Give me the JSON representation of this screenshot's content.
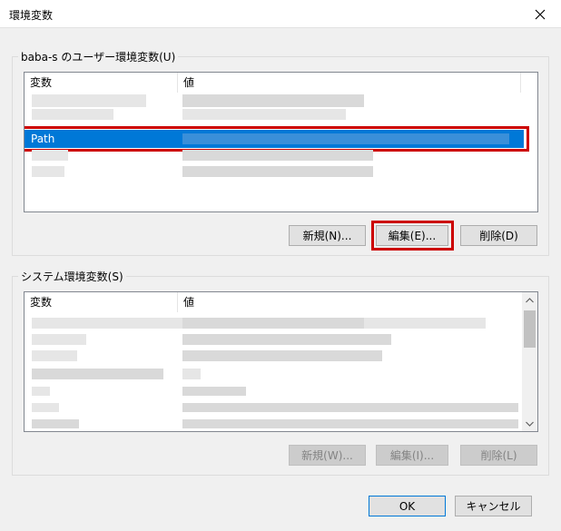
{
  "window": {
    "title": "環境変数"
  },
  "user_group": {
    "label": "baba-s のユーザー環境変数(U)",
    "columns": [
      "変数",
      "値"
    ],
    "selected_variable": "Path",
    "buttons": {
      "new": "新規(N)...",
      "edit": "編集(E)...",
      "delete": "削除(D)"
    }
  },
  "system_group": {
    "label": "システム環境変数(S)",
    "columns": [
      "変数",
      "値"
    ],
    "buttons": {
      "new": "新規(W)...",
      "edit": "編集(I)...",
      "delete": "削除(L)"
    }
  },
  "footer": {
    "ok": "OK",
    "cancel": "キャンセル"
  },
  "colors": {
    "selection": "#0078d7",
    "highlight_box": "#cc0000",
    "background": "#f0f0f0"
  },
  "icons": [
    "close-icon",
    "scroll-up-icon",
    "scroll-down-icon"
  ]
}
